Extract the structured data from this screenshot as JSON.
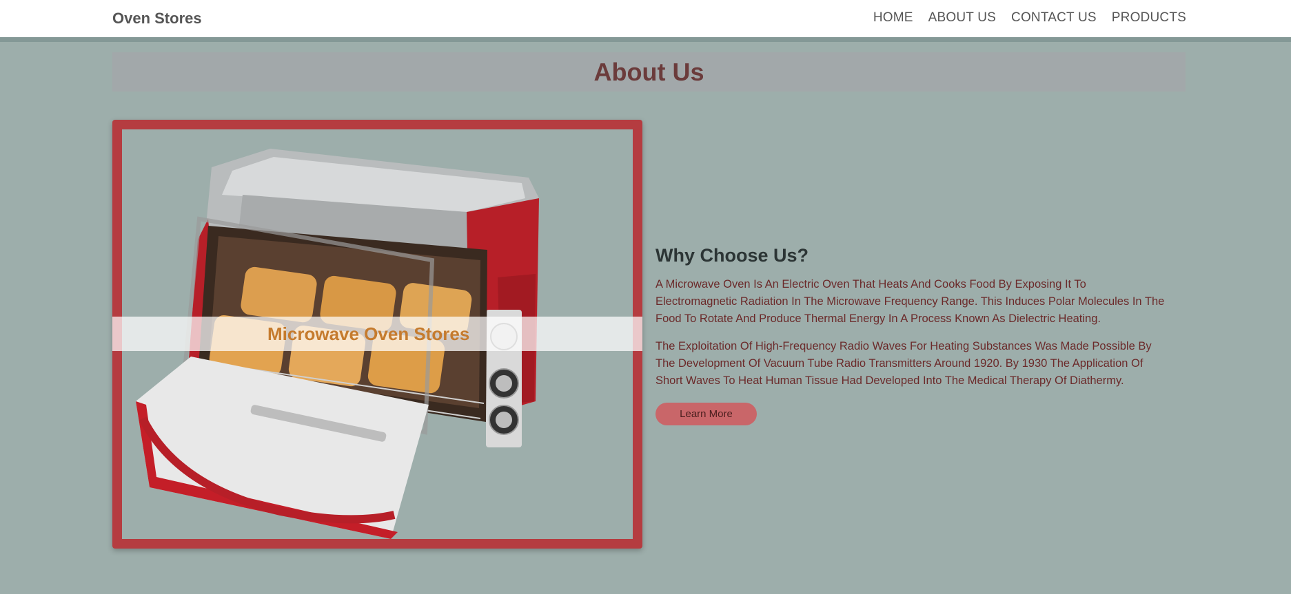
{
  "nav": {
    "brand": "Oven Stores",
    "links": [
      "HOME",
      "ABOUT US",
      "CONTACT US",
      "PRODUCTS"
    ]
  },
  "banner": {
    "title": "About Us"
  },
  "image": {
    "icon": "toaster-oven-image",
    "overlay_text": "Microwave Oven Stores"
  },
  "content": {
    "heading": "Why Choose Us?",
    "paragraphs": [
      "A Microwave Oven Is An Electric Oven That Heats And Cooks Food By Exposing It To Electromagnetic Radiation In The Microwave Frequency Range. This Induces Polar Molecules In The Food To Rotate And Produce Thermal Energy In A Process Known As Dielectric Heating.",
      "The Exploitation Of High-Frequency Radio Waves For Heating Substances Was Made Possible By The Development Of Vacuum Tube Radio Transmitters Around 1920. By 1930 The Application Of Short Waves To Heat Human Tissue Had Developed Into The Medical Therapy Of Diathermy."
    ],
    "button": "Learn More"
  },
  "colors": {
    "background": "#9daeab",
    "frame": "#b53c40",
    "banner": "#a2a8aa",
    "button": "#c96669",
    "title": "#6b3b3b"
  }
}
